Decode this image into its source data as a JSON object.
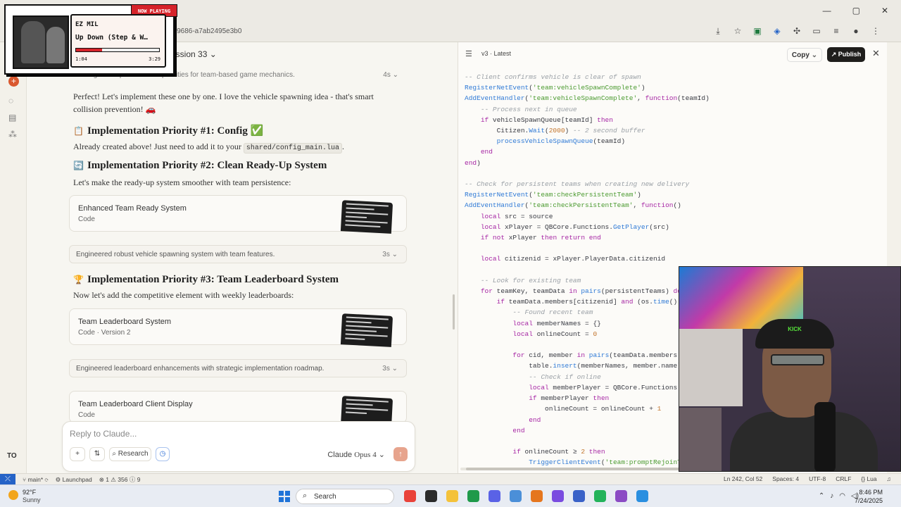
{
  "browser": {
    "url_fragment": "f-9686-a7ab2495e3b0",
    "window_controls": [
      "—",
      "▢",
      "✕"
    ]
  },
  "now_playing": {
    "badge": "NOW PLAYING",
    "artist": "EZ MIL",
    "song": "Up Down (Step & W…",
    "current_time": "1:04",
    "total_time": "3:29",
    "progress": 0.31
  },
  "chat": {
    "title": "ession 33",
    "top_thought": {
      "text": "Strategized implementation priorities for team-based game mechanics.",
      "time": "4s"
    },
    "intro": "Perfect! Let's implement these one by one. I love the vehicle spawning idea - that's smart collision prevention! 🚗",
    "priority1": {
      "emoji": "📋",
      "title": "Implementation Priority #1: Config",
      "check": "✅"
    },
    "priority1_text_before": "Already created above! Just need to add it to your",
    "priority1_code": "shared/config_main.lua",
    "priority1_text_after": ".",
    "priority2": {
      "emoji": "🔄",
      "title": "Implementation Priority #2: Clean Ready-Up System"
    },
    "priority2_text": "Let's make the ready-up system smoother with team persistence:",
    "artifact1": {
      "title": "Enhanced Team Ready System",
      "sub": "Code"
    },
    "thought2": {
      "text": "Engineered robust vehicle spawning system with team features.",
      "time": "3s"
    },
    "priority3": {
      "emoji": "🏆",
      "title": "Implementation Priority #3: Team Leaderboard System"
    },
    "priority3_text": "Now let's add the competitive element with weekly leaderboards:",
    "artifact2": {
      "title": "Team Leaderboard System",
      "sub": "Code · Version 2"
    },
    "thought3": {
      "text": "Engineered leaderboard enhancements with strategic implementation roadmap.",
      "time": "3s"
    },
    "artifact3": {
      "title": "Team Leaderboard Client Display",
      "sub": "Code"
    },
    "reply": {
      "placeholder": "Reply to Claude...",
      "add": "+",
      "tools": "⇅",
      "research": "Research",
      "model": "Claude",
      "model_version": "Opus 4",
      "send": "↑"
    }
  },
  "rail": {
    "avatar": "TO"
  },
  "code_panel": {
    "version": "v3 · Latest",
    "copy": "Copy",
    "publish": "Publish",
    "close": "✕"
  },
  "statusbar": {
    "branch": "main*",
    "launchpad": "Launchpad",
    "problems": "⊗ 1 ⚠ 356 ⓘ 9",
    "position": "Ln 242, Col 52",
    "spaces": "Spaces: 4",
    "encoding": "UTF-8",
    "eol": "CRLF",
    "lang": "Lua"
  },
  "taskbar": {
    "temp": "92°F",
    "condition": "Sunny",
    "search": "Search",
    "time": "8:46 PM",
    "date": "7/24/2025",
    "app_colors": [
      "#e9423a",
      "#2b2b2b",
      "#f4c23b",
      "#1f9a4a",
      "#5a62e6",
      "#4b8fd8",
      "#e5761e",
      "#7a4ce0",
      "#3a62c8",
      "#23b35b",
      "#8b4bc4",
      "#2a8fe0"
    ]
  }
}
